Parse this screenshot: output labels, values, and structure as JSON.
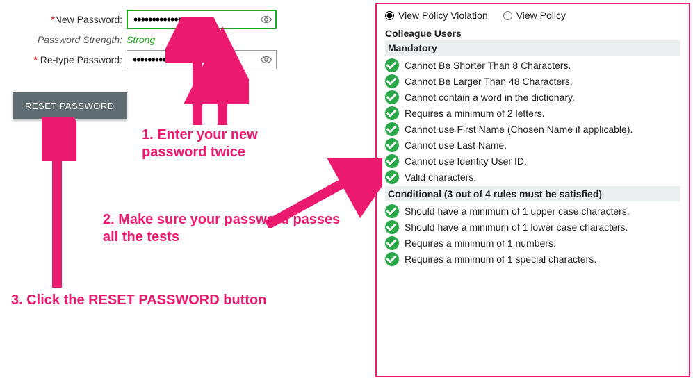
{
  "form": {
    "newPasswordLabel": "New Password:",
    "newPasswordValue": "••••••••••••••••",
    "strengthLabel": "Password Strength:",
    "strengthValue": "Strong",
    "retypeLabel": "Re-type Password:",
    "retypeValue": "••••••••••••••••",
    "resetBtn": "RESET PASSWORD"
  },
  "annotations": {
    "step1": "1. Enter your new password twice",
    "step2": "2. Make sure your password passes all the tests",
    "step3": "3. Click the RESET PASSWORD button"
  },
  "policy": {
    "radioViolation": "View Policy Violation",
    "radioPolicy": "View Policy",
    "usersTitle": "Colleague Users",
    "mandatoryTitle": "Mandatory",
    "mandatoryRules": [
      "Cannot Be Shorter Than 8 Characters.",
      "Cannot Be Larger Than 48 Characters.",
      "Cannot contain a word in the dictionary.",
      "Requires a minimum of 2 letters.",
      "Cannot use First Name (Chosen Name if applicable).",
      "Cannot use Last Name.",
      "Cannot use Identity User ID.",
      "Valid characters."
    ],
    "conditionalTitle": "Conditional (3 out of 4 rules must be satisfied)",
    "conditionalRules": [
      "Should have a minimum of 1 upper case characters.",
      "Should have a minimum of 1 lower case characters.",
      "Requires a minimum of 1 numbers.",
      "Requires a minimum of 1 special characters."
    ]
  }
}
